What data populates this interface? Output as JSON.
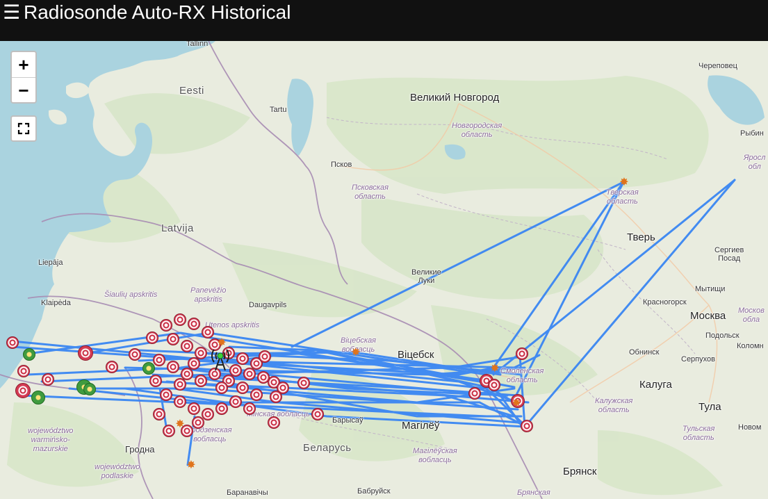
{
  "header": {
    "menu_icon": "hamburger-menu-icon",
    "title": "Radiosonde Auto-RX Historical"
  },
  "controls": {
    "zoom_in": "+",
    "zoom_out": "−",
    "fullscreen_icon": "fullscreen-icon"
  },
  "labels": {
    "tallinn": "Tallinn",
    "eesti": "Eesti",
    "tartu": "Tartu",
    "pskov": "Псков",
    "pskov_region": "Псковская\nобласть",
    "novgorod": "Великий Новгород",
    "novgorod_region": "Новгородская\nобласть",
    "cherepovets": "Череповец",
    "rybinsk": "Рыбин",
    "yaroslavl_region": "Яросл\nобл",
    "tver_region": "Тверская\nобласть",
    "tver": "Тверь",
    "sergiev_posad": "Сергиев\nПосад",
    "latvija": "Latvija",
    "liepaja": "Liepāja",
    "velikie_luki": "Великие\nЛуки",
    "mytishchi": "Мытищи",
    "krasnogorsk": "Красногорск",
    "moskva": "Москва",
    "moscow_region": "Москов\nобла",
    "podolsk": "Подольск",
    "kolomna": "Коломн",
    "obninsk": "Обнинск",
    "serpukhov": "Серпухов",
    "klaipeda": "Klaipėda",
    "siauliai": "Šiaulių apskritis",
    "panevezys": "Panevėžio\napskritis",
    "daugavpils": "Daugavpils",
    "utena": "Utenos apskritis",
    "vitebsk_region": "Віцебская\nвобласць",
    "vitsebsk": "Віцебск",
    "smolensk_region": "Смоленская\nобласть",
    "kaluga": "Калуга",
    "kaluga_region": "Калужская\nобласть",
    "tula": "Тула",
    "tula_region": "Тульская\nобласть",
    "novomoskovsk": "Новом",
    "warminsko": "województwo\nwarmińsko-\nmazurskie",
    "grodno": "Гродна",
    "grodno_region": "Гродзенская\nвобласць",
    "minsk_region": "Мінская вобласць",
    "barysau": "Барысаў",
    "mahilyow": "Магілёў",
    "belarus": "Беларусь",
    "mogilev_region": "Магілёўская\nвобласць",
    "podlaskie": "województwo\npodlaskie",
    "bryansk": "Брянск",
    "bryansk_region": "Брянская",
    "baranavichy": "Баранавічы",
    "babruisk": "Бабруйск"
  },
  "colors": {
    "track": "#3a86f2",
    "land": "#e9ecdf",
    "water": "#aad3df",
    "forest": "#d7e6c8",
    "border": "#a78cb3",
    "marker_red": "#c9283e",
    "marker_green": "#3f9b3f",
    "burst": "#e0741c"
  }
}
